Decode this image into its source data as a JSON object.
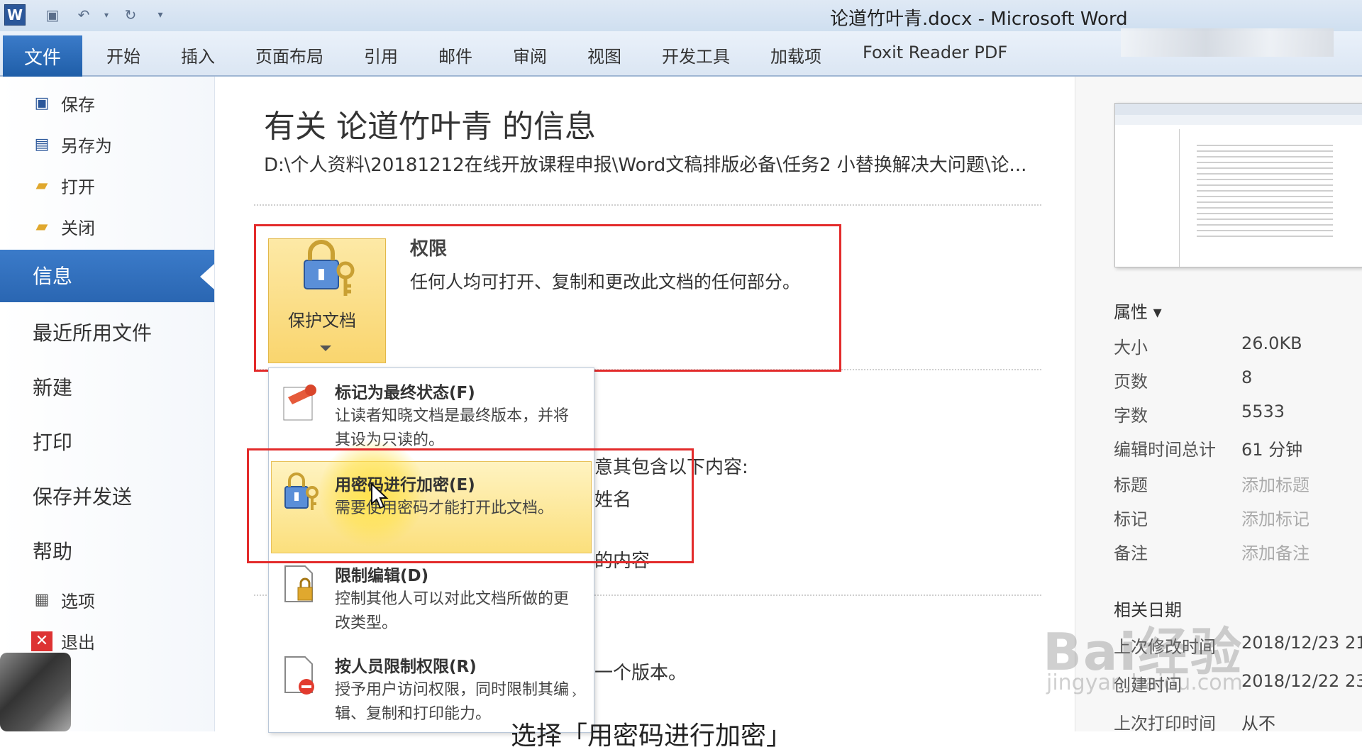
{
  "window": {
    "title": "论道竹叶青.docx - Microsoft Word"
  },
  "ribbon": {
    "file_tab": "文件",
    "tabs": [
      "开始",
      "插入",
      "页面布局",
      "引用",
      "邮件",
      "审阅",
      "视图",
      "开发工具",
      "加载项",
      "Foxit Reader PDF"
    ]
  },
  "nav": {
    "save": "保存",
    "save_as": "另存为",
    "open": "打开",
    "close": "关闭",
    "info": "信息",
    "recent": "最近所用文件",
    "new": "新建",
    "print": "打印",
    "save_send": "保存并发送",
    "help": "帮助",
    "options": "选项",
    "exit": "退出"
  },
  "main": {
    "title": "有关 论道竹叶青 的信息",
    "path": "D:\\个人资料\\20181212在线开放课程申报\\Word文稿排版必备\\任务2 小替换解决大问题\\论...",
    "protect_button": "保护文档",
    "permissions_title": "权限",
    "permissions_desc": "任何人均可打开、复制和更改此文档的任何部分。",
    "bg_line1": "意其包含以下内容:",
    "bg_line2": "姓名",
    "bg_line3": "的内容",
    "bg_line4": "一个版本。"
  },
  "dropdown": {
    "items": [
      {
        "title": "标记为最终状态(F)",
        "desc": "让读者知晓文档是最终版本，并将其设为只读的。"
      },
      {
        "title": "用密码进行加密(E)",
        "desc": "需要使用密码才能打开此文档。"
      },
      {
        "title": "限制编辑(D)",
        "desc": "控制其他人可以对此文档所做的更改类型。"
      },
      {
        "title": "按人员限制权限(R)",
        "desc": "授予用户访问权限，同时限制其编辑、复制和打印能力。"
      }
    ]
  },
  "properties": {
    "header": "属性 ▾",
    "rows": [
      {
        "key": "大小",
        "value": "26.0KB"
      },
      {
        "key": "页数",
        "value": "8"
      },
      {
        "key": "字数",
        "value": "5533"
      },
      {
        "key": "编辑时间总计",
        "value": "61 分钟"
      },
      {
        "key": "标题",
        "value": "添加标题"
      },
      {
        "key": "标记",
        "value": "添加标记"
      },
      {
        "key": "备注",
        "value": "添加备注"
      }
    ],
    "dates_header": "相关日期",
    "dates": [
      {
        "key": "上次修改时间",
        "value": "2018/12/23 21"
      },
      {
        "key": "创建时间",
        "value": "2018/12/22 23"
      },
      {
        "key": "上次打印时间",
        "value": "从不"
      }
    ]
  },
  "overlay": {
    "watermark": "Bai经验",
    "watermark_url": "jingyan.baidu.com",
    "caption": "选择「用密码进行加密」"
  }
}
